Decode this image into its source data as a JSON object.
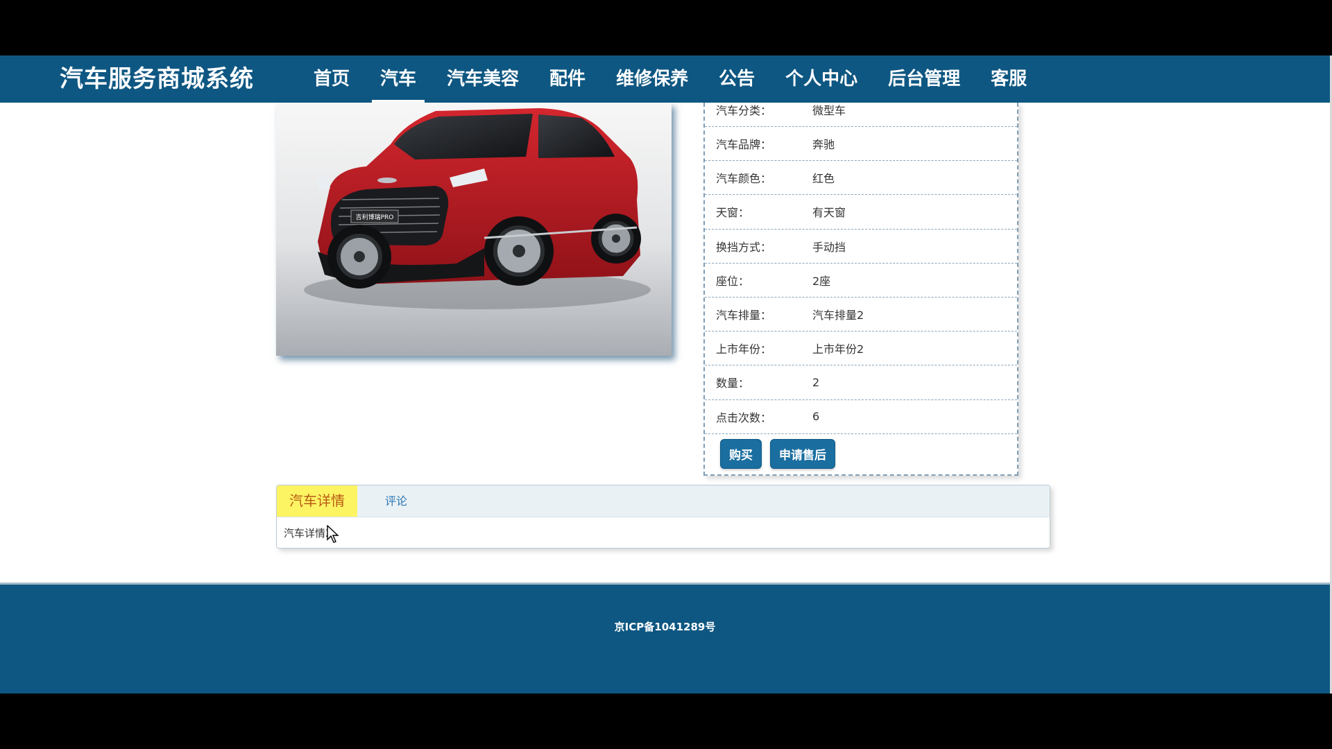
{
  "site": {
    "title": "汽车服务商城系统"
  },
  "nav": {
    "items": [
      {
        "label": "首页"
      },
      {
        "label": "汽车"
      },
      {
        "label": "汽车美容"
      },
      {
        "label": "配件"
      },
      {
        "label": "维修保养"
      },
      {
        "label": "公告"
      },
      {
        "label": "个人中心"
      },
      {
        "label": "后台管理"
      },
      {
        "label": "客服"
      }
    ],
    "active_index": 1
  },
  "car_image": {
    "badge": "吉利博瑞PRO"
  },
  "details": [
    {
      "label": "汽车分类：",
      "value": "微型车"
    },
    {
      "label": "汽车品牌：",
      "value": "奔驰"
    },
    {
      "label": "汽车颜色：",
      "value": "红色"
    },
    {
      "label": "天窗：",
      "value": "有天窗"
    },
    {
      "label": "换挡方式：",
      "value": "手动挡"
    },
    {
      "label": "座位：",
      "value": "2座"
    },
    {
      "label": "汽车排量：",
      "value": "汽车排量2"
    },
    {
      "label": "上市年份：",
      "value": "上市年份2"
    },
    {
      "label": "数量：",
      "value": "2"
    },
    {
      "label": "点击次数：",
      "value": "6"
    }
  ],
  "actions": {
    "buy": "购买",
    "after_sales": "申请售后"
  },
  "tabs": {
    "items": [
      {
        "label": "汽车详情"
      },
      {
        "label": "评论"
      }
    ],
    "content": "汽车详情2"
  },
  "footer": {
    "icp": "京ICP备1041289号"
  },
  "colors": {
    "header_bg": "#0e5782",
    "accent": "#1a6ea0",
    "active_tab": "#fdf464"
  }
}
